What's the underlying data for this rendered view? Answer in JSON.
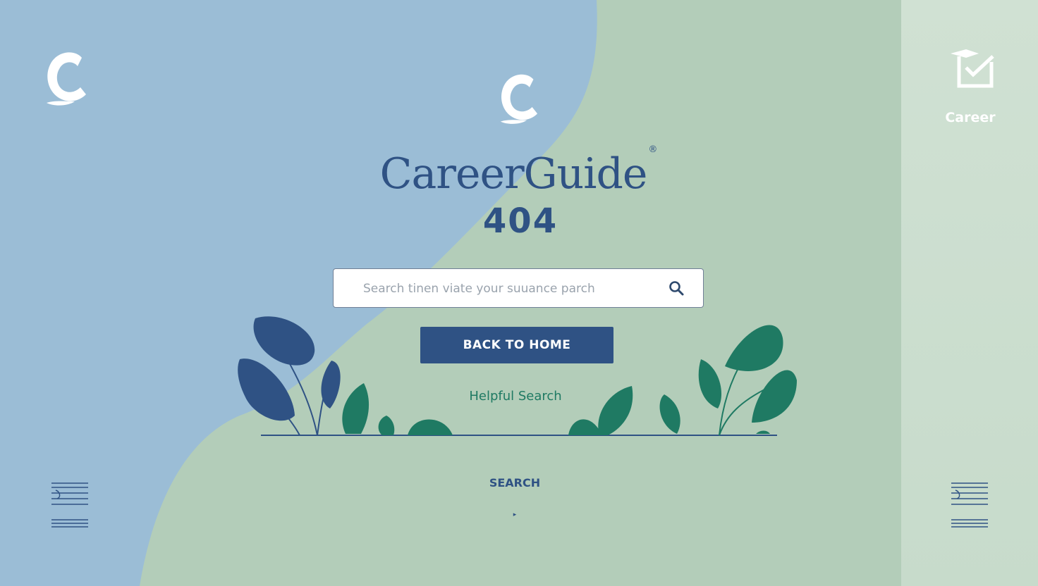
{
  "brand": {
    "name": "CareerGuide",
    "registered_mark": "®"
  },
  "error": {
    "code": "404"
  },
  "search": {
    "placeholder": "Search tinen viate your suuance parch",
    "icon": "search-icon"
  },
  "actions": {
    "back_home_label": "BACK TO HOME",
    "helpful_label": "Helpful Search",
    "search_label": "SEARCH",
    "caret": "▸"
  },
  "right_panel": {
    "career_label": "Career",
    "icon": "graduation-box-icon"
  },
  "colors": {
    "brand_blue": "#2f5284",
    "leaf_green": "#1f7a63",
    "bg_blue": "#9bbdd6",
    "bg_green": "#b3cdb9",
    "panel": "#cfe0d2"
  }
}
